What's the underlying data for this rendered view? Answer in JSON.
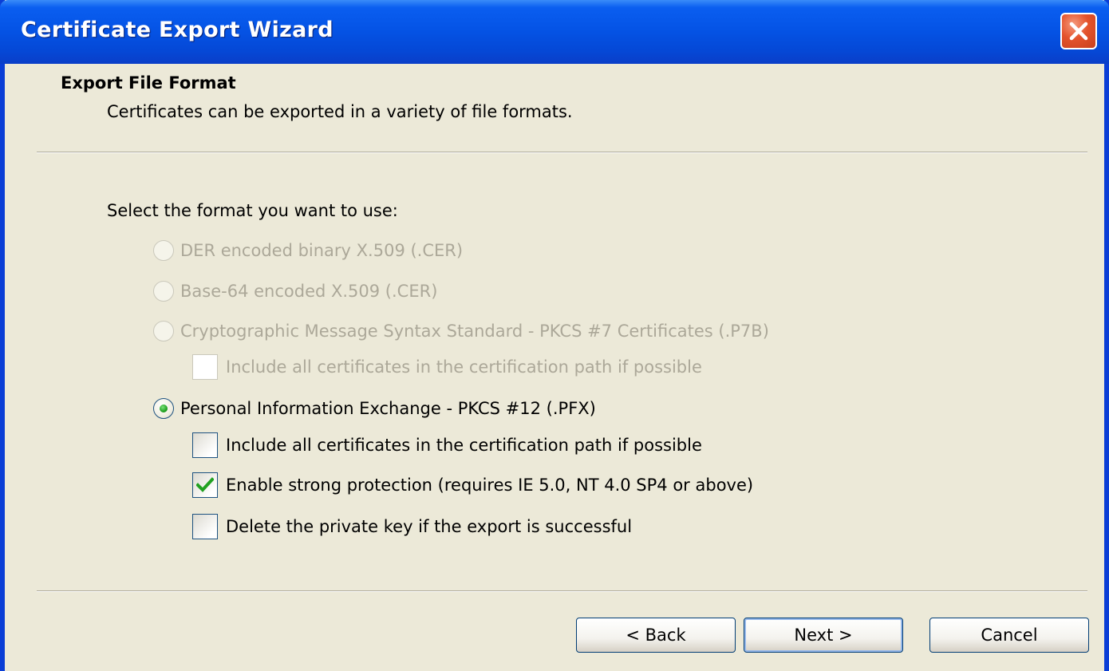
{
  "window": {
    "title": "Certificate Export Wizard"
  },
  "header": {
    "title": "Export File Format",
    "subtitle": "Certificates can be exported in a variety of file formats."
  },
  "form": {
    "prompt": "Select the format you want to use:",
    "formats": [
      {
        "label": "DER encoded binary X.509 (.CER)",
        "selected": false,
        "enabled": false
      },
      {
        "label": "Base-64 encoded X.509 (.CER)",
        "selected": false,
        "enabled": false
      },
      {
        "label": "Cryptographic Message Syntax Standard - PKCS #7 Certificates (.P7B)",
        "selected": false,
        "enabled": false
      },
      {
        "label": "Personal Information Exchange - PKCS #12 (.PFX)",
        "selected": true,
        "enabled": true
      }
    ],
    "pkcs7_options": [
      {
        "label": "Include all certificates in the certification path if possible",
        "checked": false,
        "enabled": false
      }
    ],
    "pfx_options": [
      {
        "label": "Include all certificates in the certification path if possible",
        "checked": false,
        "enabled": true
      },
      {
        "label": "Enable strong protection (requires IE 5.0, NT 4.0 SP4 or above)",
        "checked": true,
        "enabled": true
      },
      {
        "label": "Delete the private key if the export is successful",
        "checked": false,
        "enabled": true
      }
    ]
  },
  "buttons": {
    "back": "< Back",
    "next": "Next >",
    "cancel": "Cancel"
  },
  "colors": {
    "titlebar": "#0554e6",
    "dialog_background": "#ece9d8",
    "disabled_text": "#aca899",
    "check_green": "#21a121",
    "close_button": "#e4532c"
  }
}
